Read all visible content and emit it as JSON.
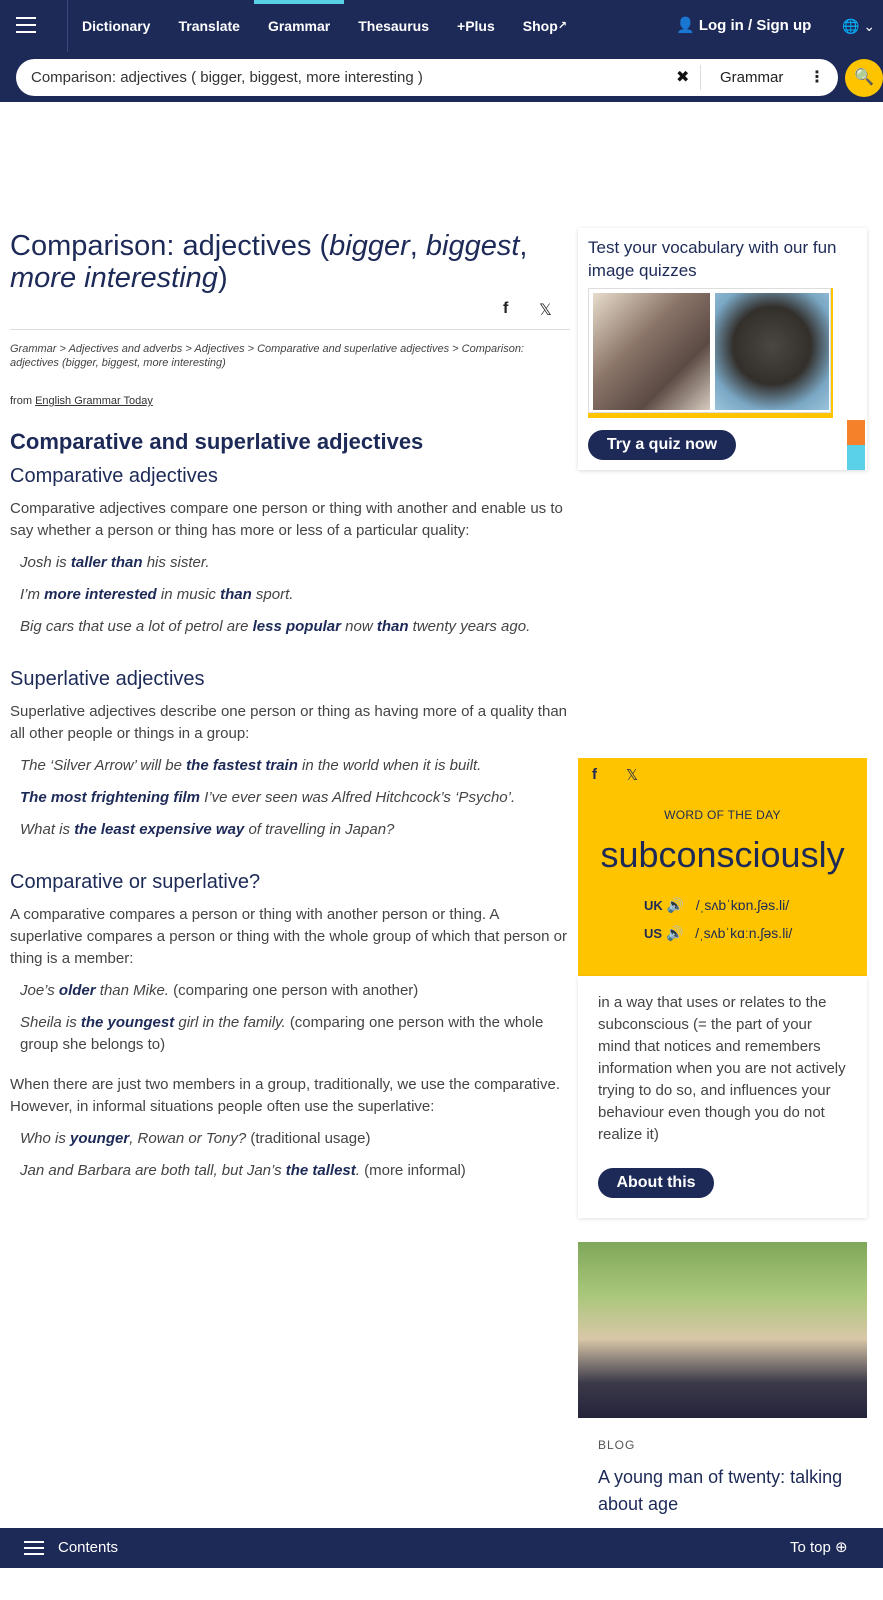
{
  "nav": {
    "links": [
      "Dictionary",
      "Translate",
      "Grammar",
      "Thesaurus",
      "+Plus",
      "Shop"
    ],
    "active": "Grammar",
    "login": "Log in / Sign up"
  },
  "search": {
    "value": "Comparison: adjectives ( bigger, biggest, more interesting )",
    "dictionary": "Grammar"
  },
  "page": {
    "title_plain_1": "Comparison: adjectives (",
    "title_i1": "bigger",
    "title_sep1": ", ",
    "title_i2": "biggest",
    "title_sep2": ", ",
    "title_i3": "more interesting",
    "title_end": ")",
    "breadcrumb": "Grammar > Adjectives and adverbs > Adjectives > Comparative and superlative adjectives > Comparison: adjectives (bigger, biggest, more interesting)",
    "from_prefix": "from ",
    "from_link": "English Grammar Today",
    "section_title": "Comparative and superlative adjectives",
    "comparative": {
      "heading": "Comparative adjectives",
      "intro": "Comparative adjectives compare one person or thing with another and enable us to say whether a person or thing has more or less of a particular quality:"
    },
    "superlative": {
      "heading": "Superlative adjectives",
      "intro": "Superlative adjectives describe one person or thing as having more of a quality than all other people or things in a group:"
    },
    "compsup": {
      "heading": "Comparative or superlative?",
      "intro": "A comparative compares a person or thing with another person or thing. A superlative compares a person or thing with the whole group of which that person or thing is a member:",
      "para2": "When there are just two members in a group, traditionally, we use the comparative. However, in informal situations people often use the superlative:"
    }
  },
  "sidebar": {
    "quiz_title": "Test your vocabulary with our fun image quizzes",
    "quiz_button": "Try a quiz now",
    "wotd_label": "WORD OF THE DAY",
    "wotd_word": "subconsciously",
    "uk_label": "UK",
    "uk_pron": "/ˌsʌbˈkɒn.ʃəs.li/",
    "us_label": "US",
    "us_pron": "/ˌsʌbˈkɑːn.ʃəs.li/",
    "wotd_def": "in a way that uses or relates to the subconscious (= the part of your mind that notices and remembers information when you are not actively trying to do so, and influences your behaviour even though you do not realize it)",
    "about_button": "About this",
    "blog_caption": "BLOG",
    "blog_title": "A young man of twenty: talking about age"
  },
  "bottom": {
    "contents": "Contents",
    "to_top": "To top"
  }
}
